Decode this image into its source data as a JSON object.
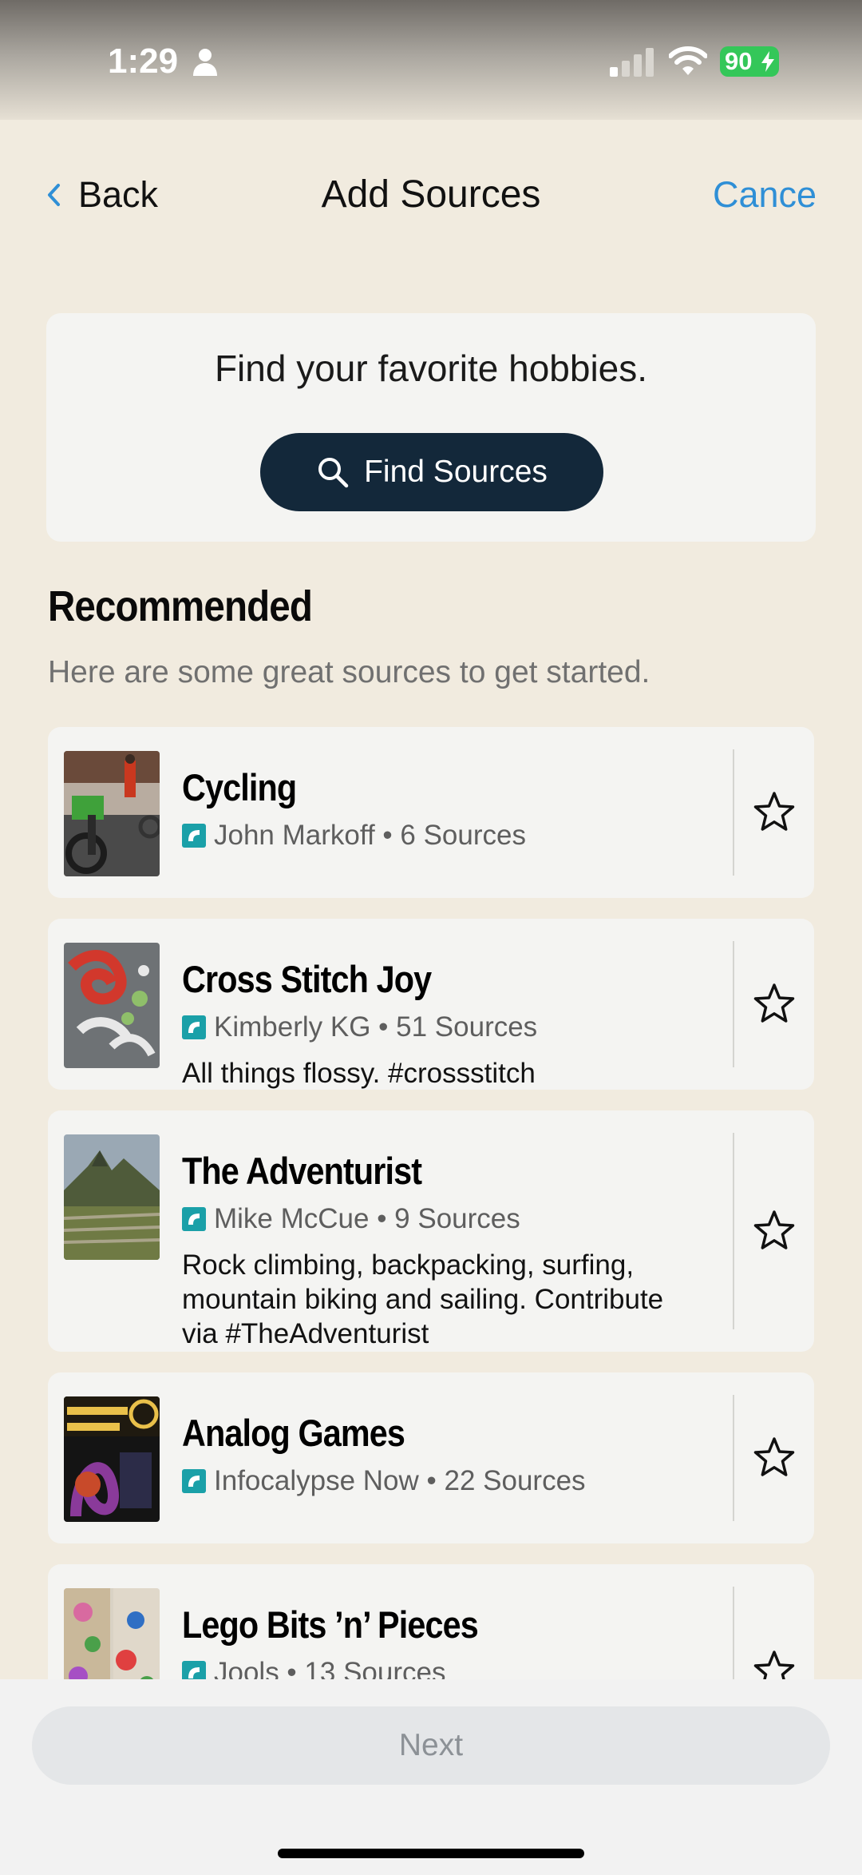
{
  "status_bar": {
    "time": "1:29",
    "battery": "90"
  },
  "nav": {
    "back_label": "Back",
    "title": "Add Sources",
    "cancel_label": "Cance"
  },
  "find_card": {
    "prompt": "Find your favorite hobbies.",
    "button_label": "Find Sources"
  },
  "recommended": {
    "title": "Recommended",
    "subtitle": "Here are some great sources to get started.",
    "items": [
      {
        "title": "Cycling",
        "meta": "John Markoff • 6 Sources",
        "description": ""
      },
      {
        "title": "Cross Stitch Joy",
        "meta": "Kimberly KG • 51 Sources",
        "description": "All things flossy. #crossstitch"
      },
      {
        "title": "The Adventurist",
        "meta": "Mike McCue • 9 Sources",
        "description": "Rock climbing, backpacking, surfing, mountain biking and sailing. Contribute via #TheAdventurist"
      },
      {
        "title": "Analog Games",
        "meta": "Infocalypse Now • 22 Sources",
        "description": ""
      },
      {
        "title": "Lego Bits ’n’ Pieces",
        "meta": "Jools • 13 Sources",
        "description": ""
      }
    ]
  },
  "footer": {
    "next_label": "Next"
  },
  "colors": {
    "background": "#f1ebdf",
    "accent": "#2f8fd6",
    "primary_button": "#13283a",
    "source_icon": "#1aa0a8"
  }
}
